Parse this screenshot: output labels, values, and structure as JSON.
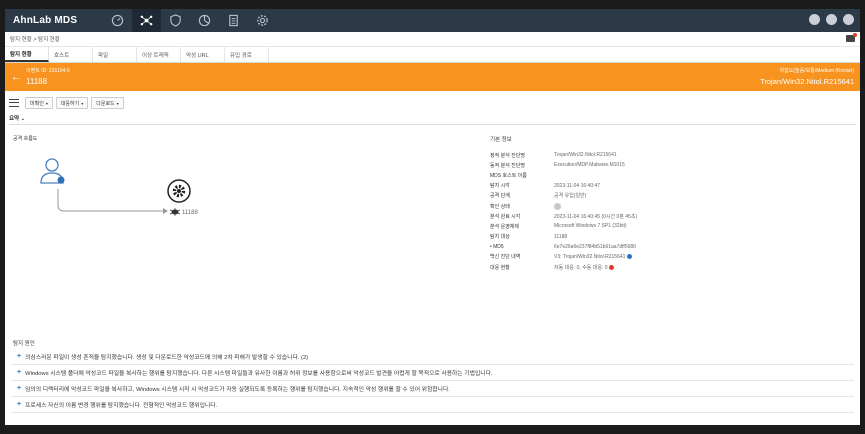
{
  "app": {
    "title": "AhnLab MDS"
  },
  "nav": {
    "icons": [
      "gauge-icon",
      "network-icon",
      "shield-icon",
      "pie-chart-icon",
      "report-icon",
      "gear-icon"
    ],
    "active_index": 1
  },
  "breadcrumb": "탐지 현황 > 탐지 현황",
  "tabs": [
    "탐지 현황",
    "호스트",
    "파일",
    "이상 트래픽",
    "악성 URL",
    "유입 경로"
  ],
  "header": {
    "event_id": "이벤트 ID: 231104-5",
    "event_num": "11188",
    "risk": "위험도(높음/보통/Medium (Known)",
    "malware": "Trojan/Win32.Nitol.R215641"
  },
  "toolbar": {
    "buttons": [
      "미확인",
      "대응하기",
      "다운로드"
    ]
  },
  "summary": {
    "label": "요약"
  },
  "flow": {
    "title": "공격 흐름도",
    "host_label": "11188"
  },
  "info": {
    "title": "기본 정보",
    "rows": [
      {
        "k": "정적 분석 진단명",
        "v": "Trojan/Win32.Nitol.R215641"
      },
      {
        "k": "동적 분석 진단명",
        "v": "Execution/MDP.Malware.M1015"
      },
      {
        "k": "MDS 호스트 이름",
        "v": ""
      },
      {
        "k": "탐지 시각",
        "v": "2023-11-04 16:40:47"
      },
      {
        "k": "공격 단계",
        "v": "공격 유입(일반)"
      },
      {
        "k": "확인 상태",
        "v": ""
      },
      {
        "k": "분석 완료 시각",
        "v": "2023-11-04 16:40:45 (0시간 0분 45초)"
      },
      {
        "k": "분석 운영체제",
        "v": "Microsoft Windows 7 SP1 (32bit)"
      },
      {
        "k": "탐지 대상",
        "v": "11188"
      },
      {
        "k": "• MD5",
        "v": "6e7e26a6e237f84b51b61aa7dff5680"
      },
      {
        "k": "백신 진단 내역",
        "v": "V3: Trojan/Win32.Nitol.R215641"
      },
      {
        "k": "대응 현황",
        "v": "자동 대응: 0, 수동 대응: 0"
      }
    ]
  },
  "cause": {
    "title": "탐지 원인",
    "items": [
      "의심스러운 파일이 생성 흔적을 탐지했습니다. 생성 및 다운로드한 악성코드에 의해 2차 피해가 발생할 수 있습니다. (2)",
      "Windows 시스템 폴더에 악성코드 파일을 복사하는 행위를 탐지했습니다. 다른 시스템 파일들과 유사한 이름과 허위 정보를 사용함으로써 악성코드 발견을 어렵게 할 목적으로 사용하는 기법입니다.",
      "임의의 디렉터리에 악성코드 파일을 복사하고, Windows 시스템 시작 시 악성코드가 자동 실행되도록 등록하는 행위를 탐지했습니다. 지속적인 악성 행위를 할 수 있어 위험합니다.",
      "프로세스 자신의 이름 변경 행위를 탐지했습니다. 전형적인 악성코드 행위입니다."
    ]
  }
}
